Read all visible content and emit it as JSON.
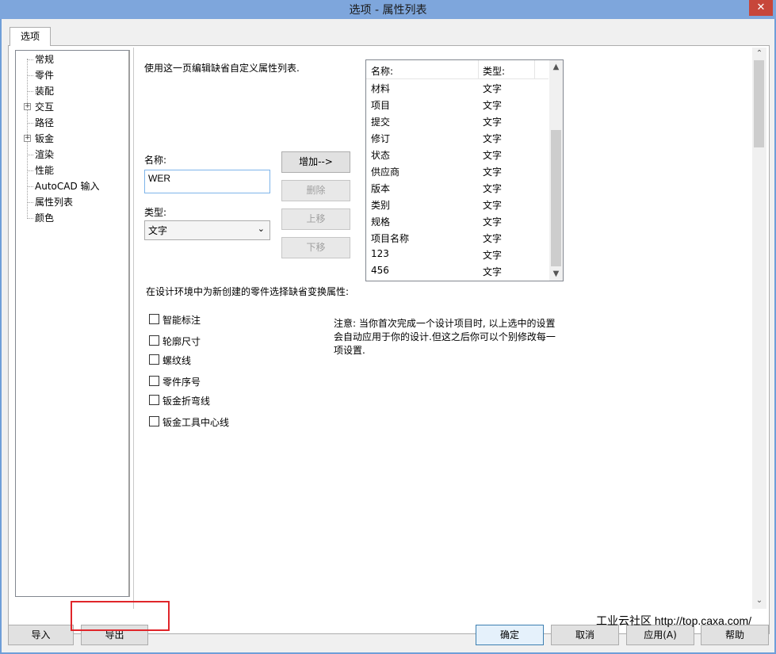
{
  "window": {
    "title": "选项 - 属性列表",
    "close_glyph": "✕"
  },
  "tab": {
    "label": "选项"
  },
  "tree": {
    "items": [
      {
        "label": "常规",
        "expandable": false
      },
      {
        "label": "零件",
        "expandable": false
      },
      {
        "label": "装配",
        "expandable": false
      },
      {
        "label": "交互",
        "expandable": true
      },
      {
        "label": "路径",
        "expandable": false
      },
      {
        "label": "钣金",
        "expandable": true
      },
      {
        "label": "渲染",
        "expandable": false
      },
      {
        "label": "性能",
        "expandable": false
      },
      {
        "label": "AutoCAD 输入",
        "expandable": false
      },
      {
        "label": "属性列表",
        "expandable": false,
        "selected": true
      },
      {
        "label": "颜色",
        "expandable": false
      }
    ]
  },
  "form": {
    "description": "使用这一页编辑缺省自定义属性列表.",
    "name_label": "名称:",
    "name_value": "WER",
    "type_label": "类型:",
    "type_value": "文字",
    "add_button": "增加-->",
    "delete_button": "删除",
    "move_up_button": "上移",
    "move_down_button": "下移"
  },
  "property_list": {
    "headers": [
      "名称:",
      "类型:"
    ],
    "rows": [
      {
        "name": "材料",
        "type": "文字"
      },
      {
        "name": "项目",
        "type": "文字"
      },
      {
        "name": "提交",
        "type": "文字"
      },
      {
        "name": "修订",
        "type": "文字"
      },
      {
        "name": "状态",
        "type": "文字"
      },
      {
        "name": "供应商",
        "type": "文字"
      },
      {
        "name": "版本",
        "type": "文字"
      },
      {
        "name": "类别",
        "type": "文字"
      },
      {
        "name": "规格",
        "type": "文字"
      },
      {
        "name": "项目名称",
        "type": "文字"
      },
      {
        "name": "123",
        "type": "文字"
      },
      {
        "name": "456",
        "type": "文字"
      }
    ]
  },
  "defaults": {
    "heading": "在设计环境中为新创建的零件选择缺省变换属性:",
    "checkboxes": [
      {
        "label": "智能标注",
        "checked": false
      },
      {
        "label": "轮廓尺寸",
        "checked": false
      },
      {
        "label": "螺纹线",
        "checked": false
      },
      {
        "label": "零件序号",
        "checked": false
      },
      {
        "label": "钣金折弯线",
        "checked": false
      },
      {
        "label": "钣金工具中心线",
        "checked": false
      }
    ]
  },
  "note": "注意: 当你首次完成一个设计项目时, 以上选中的设置会自动应用于你的设计.但这之后你可以个别修改每一项设置.",
  "footer": {
    "import": "导入",
    "export": "导出",
    "ok": "确定",
    "cancel": "取消",
    "apply": "应用(A)",
    "help": "帮助"
  },
  "watermark": "工业云社区 http://top.caxa.com/",
  "colors": {
    "title_bar": "#7ea6dc",
    "close_button": "#c7463a",
    "highlight_box": "#e0252a"
  }
}
